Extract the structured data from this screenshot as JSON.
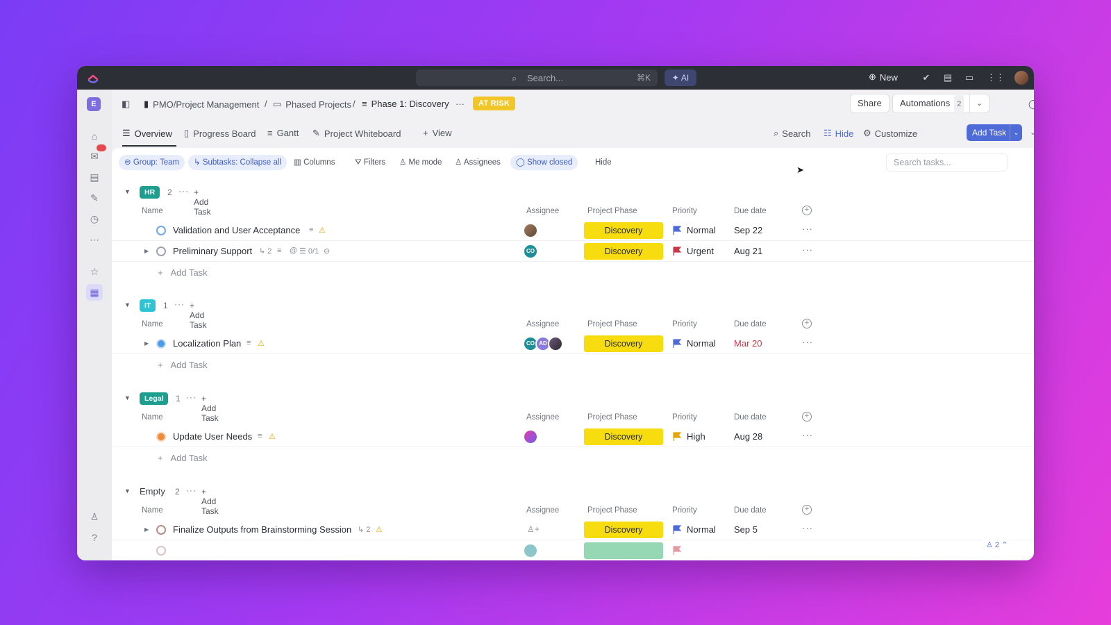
{
  "topbar": {
    "search_placeholder": "Search...",
    "search_shortcut": "⌘K",
    "ai_label": "AI",
    "new_label": "New"
  },
  "breadcrumb": {
    "space": "PMO/Project Management",
    "folder": "Phased Projects",
    "list": "Phase 1: Discovery",
    "status_badge": "AT RISK"
  },
  "header_actions": {
    "share": "Share",
    "automations": "Automations",
    "automations_count": "2"
  },
  "views": {
    "tabs": [
      "Overview",
      "Progress Board",
      "Gantt",
      "Project Whiteboard"
    ],
    "add_view": "View",
    "search": "Search",
    "hide": "Hide",
    "customize": "Customize",
    "add_task": "Add Task"
  },
  "filters": {
    "group": "Group: Team",
    "subtasks": "Subtasks: Collapse all",
    "columns": "Columns",
    "filters": "Filters",
    "me_mode": "Me mode",
    "assignees": "Assignees",
    "show_closed": "Show closed",
    "hide": "Hide",
    "search_placeholder": "Search tasks..."
  },
  "columns": {
    "name": "Name",
    "assignee": "Assignee",
    "phase": "Project Phase",
    "priority": "Priority",
    "due": "Due date"
  },
  "groups": [
    {
      "label": "HR",
      "count": "2",
      "color": "#1e9e8f",
      "add_label": "Add Task",
      "tasks": [
        {
          "name": "Validation and User Acceptance",
          "phase": "Discovery",
          "priority": "Normal",
          "due": "Sep 22"
        },
        {
          "name": "Preliminary Support",
          "subtasks": "2",
          "checklist": "0/1",
          "phase": "Discovery",
          "priority": "Urgent",
          "due": "Aug 21",
          "assignee_initials": "CO"
        }
      ],
      "add_row": "Add Task"
    },
    {
      "label": "IT",
      "count": "1",
      "color": "#2ec4d6",
      "add_label": "Add Task",
      "tasks": [
        {
          "name": "Localization Plan",
          "phase": "Discovery",
          "priority": "Normal",
          "due": "Mar 20",
          "assignee_initials": [
            "CO",
            "AD"
          ]
        }
      ],
      "add_row": "Add Task"
    },
    {
      "label": "Legal",
      "count": "1",
      "color": "#1e9e8f",
      "add_label": "Add Task",
      "tasks": [
        {
          "name": "Update User Needs",
          "phase": "Discovery",
          "priority": "High",
          "due": "Aug 28"
        }
      ],
      "add_row": "Add Task"
    },
    {
      "label": "Empty",
      "count": "2",
      "add_label": "Add Task",
      "tasks": [
        {
          "name": "Finalize Outputs from Brainstorming Session",
          "subtasks": "2",
          "phase": "Discovery",
          "priority": "Normal",
          "due": "Sep 5"
        }
      ]
    }
  ],
  "colors": {
    "discovery": "#f7dc10",
    "normal_flag": "#4f6bd8",
    "urgent_flag": "#c9384a",
    "high_flag": "#e6a400",
    "accent": "#4f6bd8"
  },
  "corner_widget": "2"
}
